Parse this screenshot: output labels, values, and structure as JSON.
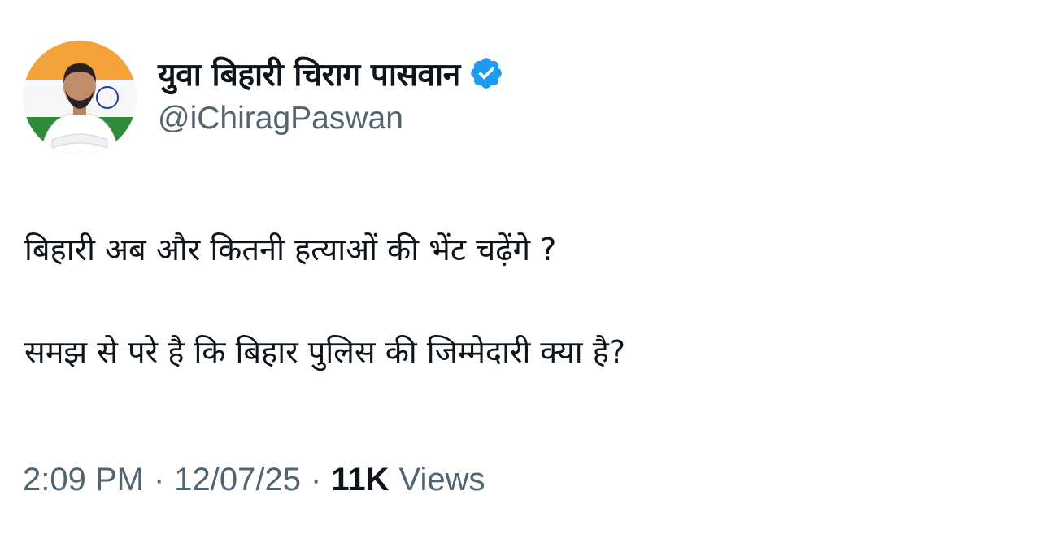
{
  "author": {
    "display_name": "युवा बिहारी चिराग पासवान",
    "handle": "@iChiragPaswan",
    "verified_icon": "verified-badge-icon",
    "verified_color": "#1d9bf0"
  },
  "tweet": {
    "line1": "बिहारी अब और कितनी हत्याओं की भेंट चढ़ेंगे ?",
    "line2": "समझ से परे है कि बिहार पुलिस की जिम्मेदारी क्या है?"
  },
  "meta": {
    "time": "2:09 PM",
    "separator": "·",
    "date": "12/07/25",
    "views_count": "11K",
    "views_label": "Views"
  },
  "colors": {
    "text_primary": "#0f1419",
    "text_secondary": "#536471",
    "flag_saffron": "#f4a23a",
    "flag_green": "#2e8b3a"
  }
}
